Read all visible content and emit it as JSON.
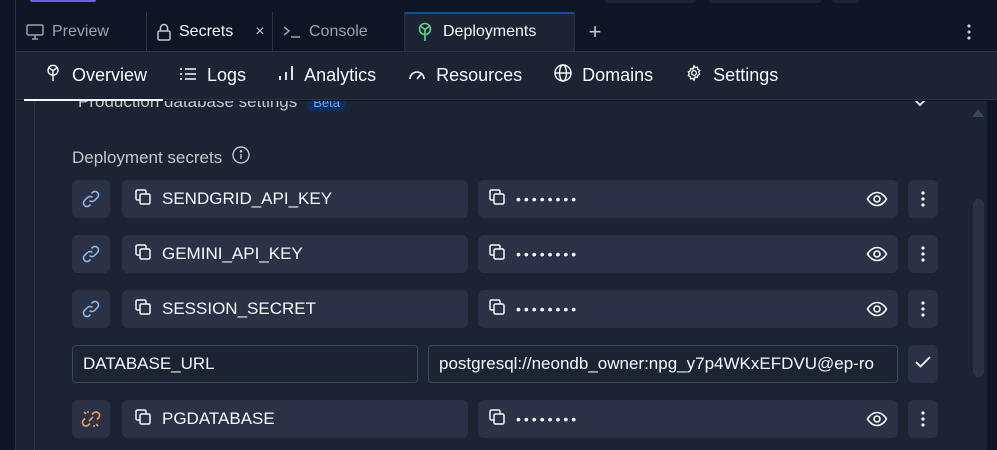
{
  "tabs": [
    {
      "label": "Preview",
      "icon": "monitor-icon"
    },
    {
      "label": "Secrets",
      "icon": "lock-icon"
    },
    {
      "label": "Console",
      "icon": "terminal-icon"
    },
    {
      "label": "Deployments",
      "icon": "deployments-icon"
    }
  ],
  "close_glyph": "×",
  "add_tab_glyph": "+",
  "nav": [
    {
      "label": "Overview",
      "icon": "deployments-icon"
    },
    {
      "label": "Logs",
      "icon": "list-icon"
    },
    {
      "label": "Analytics",
      "icon": "bar-chart-icon"
    },
    {
      "label": "Resources",
      "icon": "gauge-icon"
    },
    {
      "label": "Domains",
      "icon": "globe-icon"
    },
    {
      "label": "Settings",
      "icon": "gear-icon"
    }
  ],
  "partial_header": {
    "text": "Production database settings",
    "badge": "Beta"
  },
  "section": {
    "label": "Deployment secrets"
  },
  "secrets": [
    {
      "key": "SENDGRID_API_KEY",
      "masked": "••••••••",
      "link_status": "linked"
    },
    {
      "key": "GEMINI_API_KEY",
      "masked": "••••••••",
      "link_status": "linked"
    },
    {
      "key": "SESSION_SECRET",
      "masked": "••••••••",
      "link_status": "linked"
    }
  ],
  "editing": {
    "key": "DATABASE_URL",
    "value": "postgresql://neondb_owner:npg_y7p4WKxEFDVU@ep-ro"
  },
  "last_secret": {
    "key": "PGDATABASE",
    "masked": "••••••••",
    "link_status": "unlinked"
  },
  "colors": {
    "linked": "#8fb4e8",
    "unlinked": "#e3a06a",
    "active_tab_accent": "#0053a6",
    "badge_text": "#57abff"
  }
}
